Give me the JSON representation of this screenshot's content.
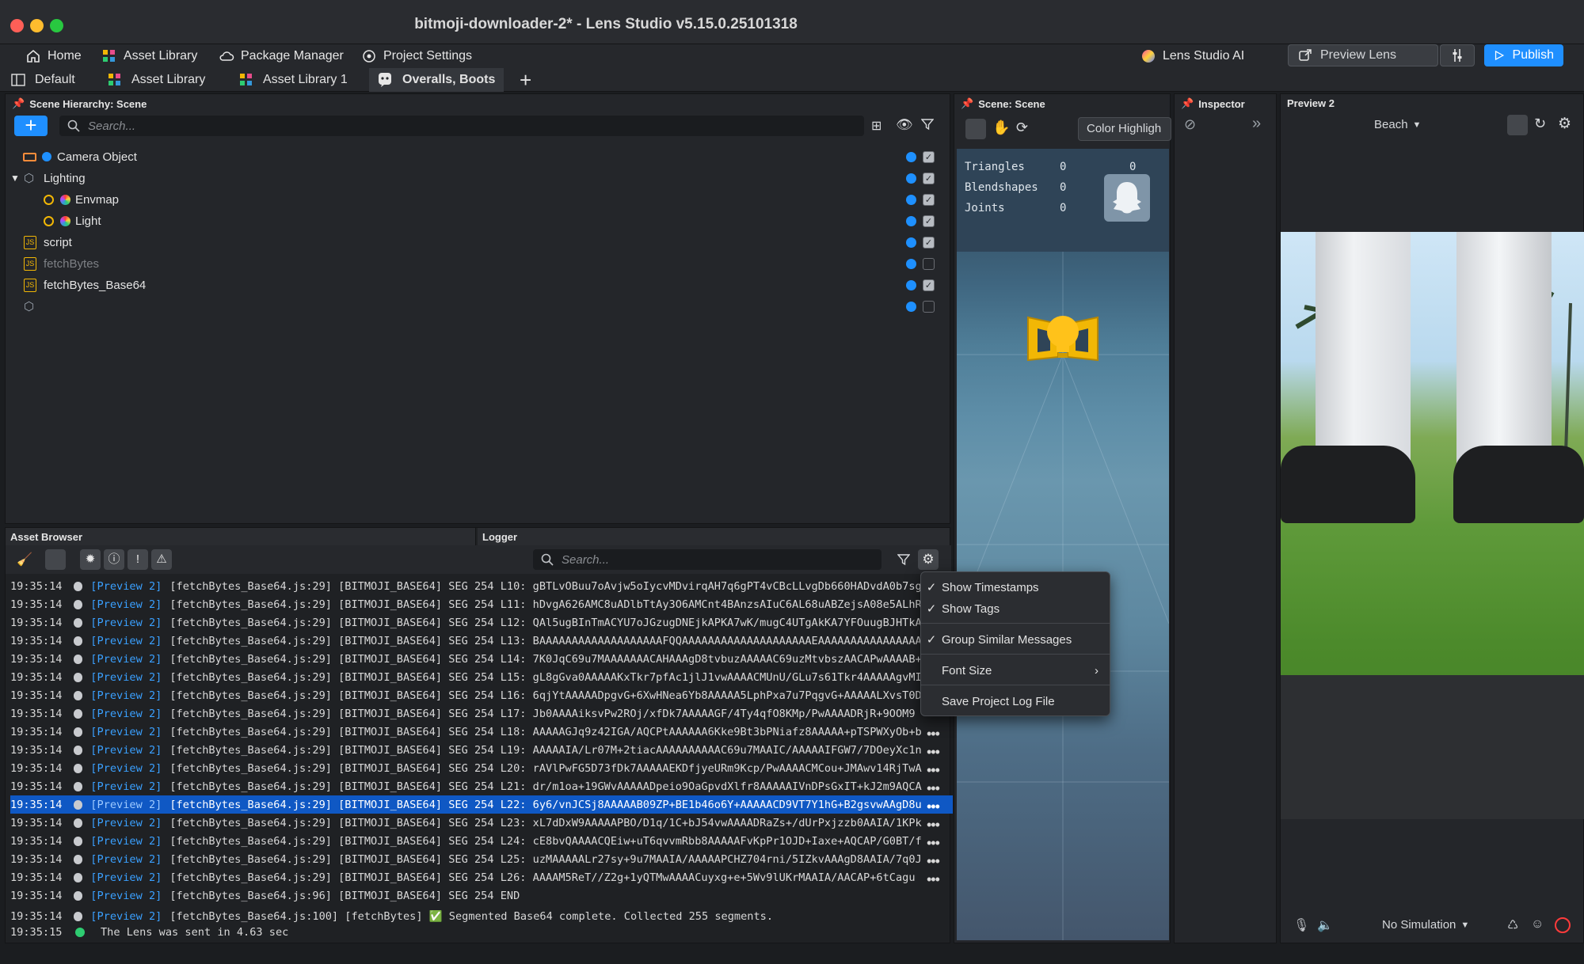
{
  "window": {
    "title": "bitmoji-downloader-2* - Lens Studio v5.15.0.25101318"
  },
  "menu": {
    "items": [
      "Home",
      "Asset Library",
      "Package Manager",
      "Project Settings"
    ],
    "ai_label": "Lens Studio AI",
    "preview_lens_label": "Preview Lens",
    "publish_label": "Publish"
  },
  "tabs": [
    "Default",
    "Asset Library",
    "Asset Library 1",
    "Overalls, Boots"
  ],
  "scene_hierarchy": {
    "title": "Scene Hierarchy: Scene",
    "search_placeholder": "Search...",
    "items": [
      {
        "label": "Camera Object",
        "visible": true,
        "enabled": true
      },
      {
        "label": "Lighting",
        "visible": true,
        "enabled": true
      },
      {
        "label": "Envmap",
        "visible": true,
        "enabled": true
      },
      {
        "label": "Light",
        "visible": true,
        "enabled": true
      },
      {
        "label": "script",
        "visible": true,
        "enabled": true
      },
      {
        "label": "fetchBytes",
        "visible": true,
        "enabled": false
      },
      {
        "label": "fetchBytes_Base64",
        "visible": true,
        "enabled": true
      },
      {
        "label": "",
        "visible": true,
        "enabled": false
      }
    ]
  },
  "bottom_tabs": {
    "asset_browser": "Asset Browser",
    "logger": "Logger"
  },
  "logger": {
    "search_placeholder": "Search...",
    "rows": [
      {
        "ts": "19:35:14",
        "tag": "[Preview 2]",
        "msg": "[fetchBytes_Base64.js:29] [BITMOJI_BASE64] SEG 254 L10: gBTLvOBuu7oAvjw5oIycvMDvirqAH7q6gPT4vCBcLLvgDb660HADvdA0b7sg"
      },
      {
        "ts": "19:35:14",
        "tag": "[Preview 2]",
        "msg": "[fetchBytes_Base64.js:29] [BITMOJI_BASE64] SEG 254 L11: hDvgA626AMC8uADlbTtAy3O6AMCnt4BAnzsAIuC6AL68uABZejsA08e5ALhR"
      },
      {
        "ts": "19:35:14",
        "tag": "[Preview 2]",
        "msg": "[fetchBytes_Base64.js:29] [BITMOJI_BASE64] SEG 254 L12: QAl5ugBInTmACYU7oJGzugDNEjkAPKA7wK/mugC4UTgAkKA7YFOuugBJHTkA"
      },
      {
        "ts": "19:35:14",
        "tag": "[Preview 2]",
        "msg": "[fetchBytes_Base64.js:29] [BITMOJI_BASE64] SEG 254 L13: BAAAAAAAAAAAAAAAAAAAFQQAAAAAAAAAAAAAAAAAAAAEAAAAAAAAAAAAAAAA"
      },
      {
        "ts": "19:35:14",
        "tag": "[Preview 2]",
        "msg": "[fetchBytes_Base64.js:29] [BITMOJI_BASE64] SEG 254 L14: 7K0JqC69u7MAAAAAAACAHAAAgD8tvbuzAAAAAC69uzMtvbszAACAPwAAAAB+"
      },
      {
        "ts": "19:35:14",
        "tag": "[Preview 2]",
        "msg": "[fetchBytes_Base64.js:29] [BITMOJI_BASE64] SEG 254 L15: gL8gGva0AAAAAKxTkr7pfAc1jlJ1vwAAAACMUnU/GLu7s61Tkr4AAAAAgvMI"
      },
      {
        "ts": "19:35:14",
        "tag": "[Preview 2]",
        "msg": "[fetchBytes_Base64.js:29] [BITMOJI_BASE64] SEG 254 L16: 6qjYtAAAAADpgvG+6XwHNea6Yb8AAAAA5LphPxa7u7PqgvG+AAAAALXvsT0D"
      },
      {
        "ts": "19:35:14",
        "tag": "[Preview 2]",
        "msg": "[fetchBytes_Base64.js:29] [BITMOJI_BASE64] SEG 254 L17: Jb0AAAAiksvPw2ROj/xfDk7AAAAAGF/4Ty4qfO8KMp/PwAAAADRjR+9OOM9"
      },
      {
        "ts": "19:35:14",
        "tag": "[Preview 2]",
        "msg": "[fetchBytes_Base64.js:29] [BITMOJI_BASE64] SEG 254 L18: AAAAAGJq9z42IGA/AQCPtAAAAAA6Kke9Bt3bPNiafz8AAAAA+pTSPWXyOb+b"
      },
      {
        "ts": "19:35:14",
        "tag": "[Preview 2]",
        "msg": "[fetchBytes_Base64.js:29] [BITMOJI_BASE64] SEG 254 L19: AAAAAIA/Lr07M+2tiacAAAAAAAAAAC69u7MAAIC/AAAAAIFGW7/7DOeyXc1n"
      },
      {
        "ts": "19:35:14",
        "tag": "[Preview 2]",
        "msg": "[fetchBytes_Base64.js:29] [BITMOJI_BASE64] SEG 254 L20: rAVlPwFG5D73fDk7AAAAAEKDfjyeURm9Kcp/PwAAAACMCou+JMAwv14RjTwA"
      },
      {
        "ts": "19:35:14",
        "tag": "[Preview 2]",
        "msg": "[fetchBytes_Base64.js:29] [BITMOJI_BASE64] SEG 254 L21: dr/m1oa+19GWvAAAAADpeio9OaGpvdXlfr8AAAAAIVnDPsGxIT+kJ2m9AQCA"
      },
      {
        "ts": "19:35:14",
        "tag": "[Preview 2]",
        "msg": "[fetchBytes_Base64.js:29] [BITMOJI_BASE64] SEG 254 L22: 6y6/vnJCSj8AAAAAB09ZP+BE1b46o6Y+AAAAACD9VT7Y1hG+B2gsvwAAgD8u"
      },
      {
        "ts": "19:35:14",
        "tag": "[Preview 2]",
        "msg": "[fetchBytes_Base64.js:29] [BITMOJI_BASE64] SEG 254 L23: xL7dDxW9AAAAAPBO/D1q/1C+bJ54vwAAAADRaZs+/dUrPxjzzb0AAIA/1KPk"
      },
      {
        "ts": "19:35:14",
        "tag": "[Preview 2]",
        "msg": "[fetchBytes_Base64.js:29] [BITMOJI_BASE64] SEG 254 L24: cE8bvQAAAACQEiw+uT6qvvmRbb8AAAAAFvKpPr1OJD+Iaxe+AQCAP/G0BT/f"
      },
      {
        "ts": "19:35:14",
        "tag": "[Preview 2]",
        "msg": "[fetchBytes_Base64.js:29] [BITMOJI_BASE64] SEG 254 L25: uzMAAAAALr27sy+9u7MAAIA/AAAAAPCHZ704rni/5IZkvAAAgD8AAIA/7q0J"
      },
      {
        "ts": "19:35:14",
        "tag": "[Preview 2]",
        "msg": "[fetchBytes_Base64.js:29] [BITMOJI_BASE64] SEG 254 L26: AAAAM5ReT//Z2g+1yQTMwAAAACuyxg+e+5Wv9lUKrMAAIA/AACAP+6tCagu"
      },
      {
        "ts": "19:35:14",
        "tag": "[Preview 2]",
        "msg": "[fetchBytes_Base64.js:96] [BITMOJI_BASE64] SEG 254 END"
      },
      {
        "ts": "19:35:14",
        "tag": "[Preview 2]",
        "msg": "[fetchBytes_Base64.js:100] [fetchBytes] ✅ Segmented Base64 complete. Collected 255 segments."
      },
      {
        "ts": "19:35:15",
        "tag": "",
        "msg": "The Lens was sent in 4.63 sec"
      }
    ]
  },
  "context_menu": {
    "show_timestamps": "Show Timestamps",
    "show_tags": "Show Tags",
    "group_similar": "Group Similar Messages",
    "font_size": "Font Size",
    "save_log": "Save Project Log File"
  },
  "scene_panel": {
    "title": "Scene: Scene",
    "color_highlight": "Color Highligh",
    "stats": [
      {
        "label": "Triangles",
        "value": "0",
        "value2": "0"
      },
      {
        "label": "Blendshapes",
        "value": "0"
      },
      {
        "label": "Joints",
        "value": "0"
      }
    ]
  },
  "inspector": {
    "title": "Inspector"
  },
  "preview": {
    "title": "Preview 2",
    "environment": "Beach",
    "simulation": "No Simulation"
  },
  "colors": {
    "accent": "#1e90ff",
    "selection": "#0f58c4",
    "publish": "#1f8fff"
  }
}
